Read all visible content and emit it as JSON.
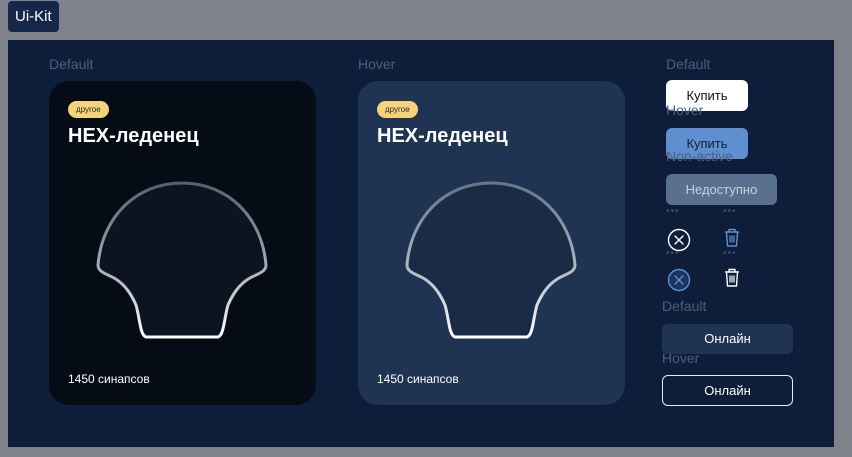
{
  "kit": {
    "title": "Ui-Kit"
  },
  "labels": {
    "cards_default": "Default",
    "cards_hover": "Hover",
    "buy_default": "Default",
    "buy_hover": "Hover",
    "buy_nonactive": "Non-active",
    "online_default": "Default",
    "online_hover": "Hover"
  },
  "cards": [
    {
      "state": "default",
      "badge": "другое",
      "title": "HEX-леденец",
      "price": "1450 синапсов"
    },
    {
      "state": "hover",
      "badge": "другое",
      "title": "HEX-леденец",
      "price": "1450 синапсов"
    }
  ],
  "buttons": {
    "buy_default": "Купить",
    "buy_hover": "Купить",
    "buy_disabled": "Недоступно",
    "online_default": "Онлайн",
    "online_hover": "Онлайн"
  },
  "colors": {
    "page_bg": "#7f828b",
    "frame_bg": "#0e1e3a",
    "card_default_bg": "#050c15",
    "card_hover_bg": "#1f3352",
    "badge_bg": "#f5d37a",
    "accent": "#5f8fd0"
  },
  "icons": [
    "close-circle-icon",
    "trash-icon"
  ]
}
